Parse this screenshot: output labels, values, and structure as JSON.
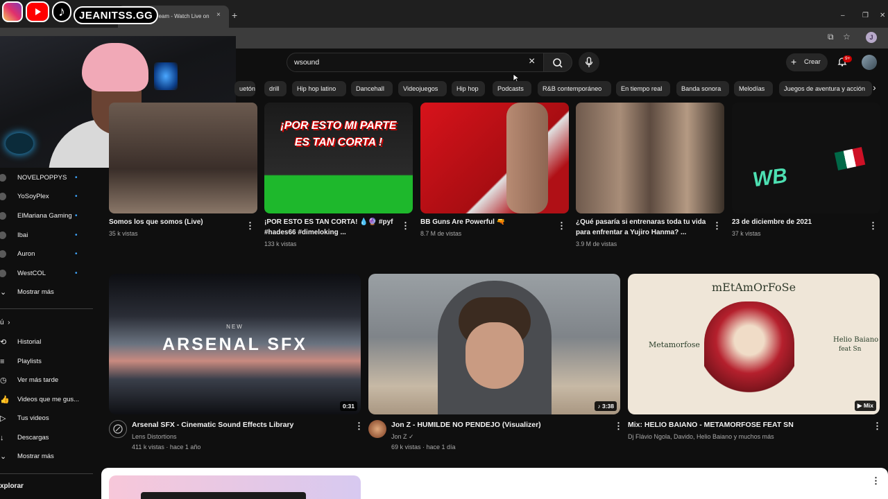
{
  "browser": {
    "tab_title": "ss Stream - Watch Live on",
    "tab_close": "×",
    "new_tab": "+",
    "profile_letter": "J"
  },
  "overlay": {
    "handle": "JEANITSS.GG"
  },
  "search": {
    "query": "wsound",
    "clear_icon": "×"
  },
  "header": {
    "create_label": "Crear",
    "notif_badge": "9+"
  },
  "chips": [
    "uetón",
    "drill",
    "Hip hop latino",
    "Dancehall",
    "Videojuegos",
    "Hip hop",
    "Podcasts",
    "R&B contemporáneo",
    "En tiempo real",
    "Banda sonora",
    "Melodías",
    "Juegos de aventura y acción"
  ],
  "sidebar": {
    "subscriptions": [
      {
        "label": "NOVELPOPPYS"
      },
      {
        "label": "YoSoyPlex"
      },
      {
        "label": "ElMariana Gaming"
      },
      {
        "label": "Ibai"
      },
      {
        "label": "Auron"
      },
      {
        "label": "WestCOL"
      }
    ],
    "show_more_1": "Mostrar más",
    "you_label": "ú",
    "you_items": [
      {
        "label": "Historial"
      },
      {
        "label": "Playlists"
      },
      {
        "label": "Ver más tarde"
      },
      {
        "label": "Videos que me gus..."
      },
      {
        "label": "Tus videos"
      },
      {
        "label": "Descargas"
      }
    ],
    "show_more_2": "Mostrar más",
    "explore": "xplorar"
  },
  "row1": [
    {
      "title": "Somos los que somos (Live)",
      "meta1": "35 k vistas",
      "meta2": ""
    },
    {
      "title": "¡POR ESTO ES TAN CORTA! 💧🔮 #pyf #hades66 #dimeloking ...",
      "meta1": "133 k vistas",
      "meta2": "",
      "overlay_text": "¡POR ESTO MI PARTE ES TAN CORTA !"
    },
    {
      "title": "BB Guns Are Powerful 🔫",
      "meta1": "8.7 M de vistas",
      "meta2": ""
    },
    {
      "title": "¿Qué pasaría si entrenaras toda tu vida para enfrentar a Yujiro Hanma? ...",
      "meta1": "3.9 M de vistas",
      "meta2": ""
    },
    {
      "title": "23 de diciembre de 2021",
      "meta1": "37 k vistas",
      "meta2": "",
      "overlay_text": "WB"
    }
  ],
  "row2": [
    {
      "title": "Arsenal SFX - Cinematic Sound Effects Library",
      "channel": "Lens Distortions",
      "meta": "411 k vistas · hace 1 año",
      "duration": "0:31",
      "thumb_text": "ARSENAL SFX",
      "thumb_small": "NEW"
    },
    {
      "title": "Jon Z -  HUMILDE NO PENDEJO (Visualizer)",
      "channel": "Jon Z ✓",
      "meta": "69 k vistas · hace 1 día",
      "duration": "♪ 3:38"
    },
    {
      "title": "Mix: HELIO BAIANO  - METAMORFOSE FEAT SN",
      "channel": "Dj Flávio Ngola, Davido, Helio Baiano y muchos más",
      "meta": "",
      "duration": "▶ Mix",
      "thumb_title": "mEtAmOrFoSe",
      "thumb_left": "Metamorfose",
      "thumb_right": "Helio Baiano",
      "thumb_right2": "feat Sn"
    }
  ],
  "colors": {
    "background": "#0f0f0f",
    "chip": "#272727",
    "text": "#f1f1f1",
    "muted": "#aaaaaa",
    "badge": "#cc0000"
  }
}
